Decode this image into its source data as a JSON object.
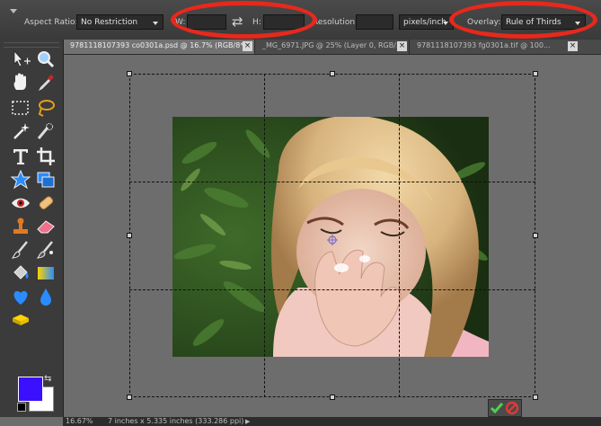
{
  "options_bar": {
    "aspect_ratio_label": "Aspect Ratio:",
    "aspect_ratio_value": "No Restriction",
    "width_label": "W:",
    "height_label": "H:",
    "resolution_label": "Resolution:",
    "resolution_unit": "pixels/inch",
    "overlay_label": "Overlay:",
    "overlay_value": "Rule of Thirds",
    "highlight_color": "#e8281c"
  },
  "tabs": [
    {
      "label": "9781118107393 co0301a.psd @ 16.7% (RGB/8*)",
      "active": true
    },
    {
      "label": "_MG_6971.JPG @ 25% (Layer 0, RGB/...",
      "active": false
    },
    {
      "label": "9781118107393 fg0301a.tif @ 100...",
      "active": false
    }
  ],
  "tools": [
    "move-icon",
    "zoom-icon",
    "hand-icon",
    "eyedropper-icon",
    "marquee-icon",
    "lasso-icon",
    "magic-wand-icon",
    "quick-selection-icon",
    "type-icon",
    "crop-icon",
    "cookie-cutter-icon",
    "straighten-icon",
    "red-eye-icon",
    "spot-healing-icon",
    "clone-stamp-icon",
    "eraser-icon",
    "brush-icon",
    "smart-brush-icon",
    "paint-bucket-icon",
    "gradient-icon",
    "custom-shape-icon",
    "blur-icon",
    "sponge-icon"
  ],
  "colors": {
    "foreground": "#3a10ff",
    "background": "#ffffff"
  },
  "status_bar": {
    "zoom": "16.67%",
    "doc_size": "7 inches x 5.335 inches (333.286 ppi)"
  }
}
